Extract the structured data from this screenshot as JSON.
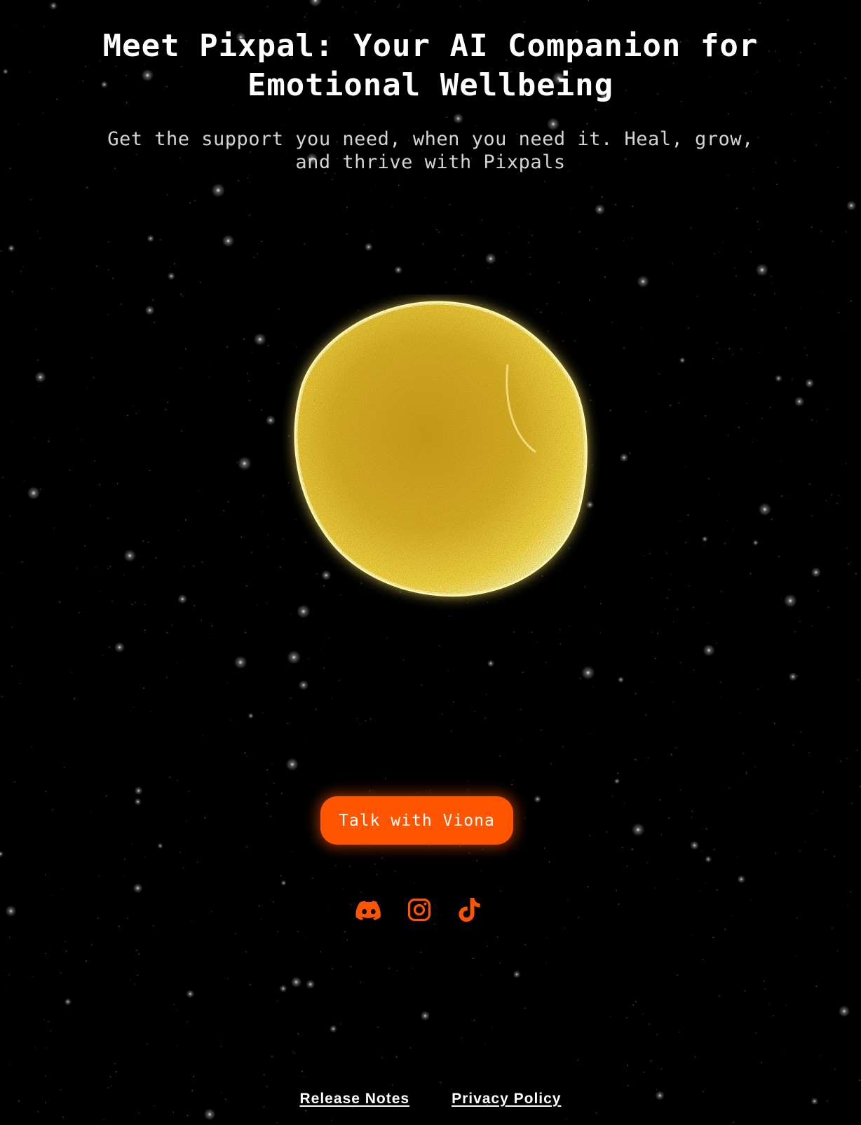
{
  "hero": {
    "title": "Meet Pixpal: Your AI Companion for Emotional Wellbeing",
    "subtitle": "Get the support you need, when you need it. Heal, grow, and thrive with Pixpals"
  },
  "cta": {
    "label": "Talk with Viona"
  },
  "socials": [
    {
      "icon": "discord-icon"
    },
    {
      "icon": "instagram-icon"
    },
    {
      "icon": "tiktok-icon"
    }
  ],
  "footer": {
    "links": [
      {
        "label": "Release Notes"
      },
      {
        "label": "Privacy Policy"
      }
    ]
  },
  "colors": {
    "background": "#000000",
    "accent": "#ff5500",
    "orb": "#ffd43b",
    "text": "#ffffff",
    "subtext": "#d4d4d4"
  }
}
